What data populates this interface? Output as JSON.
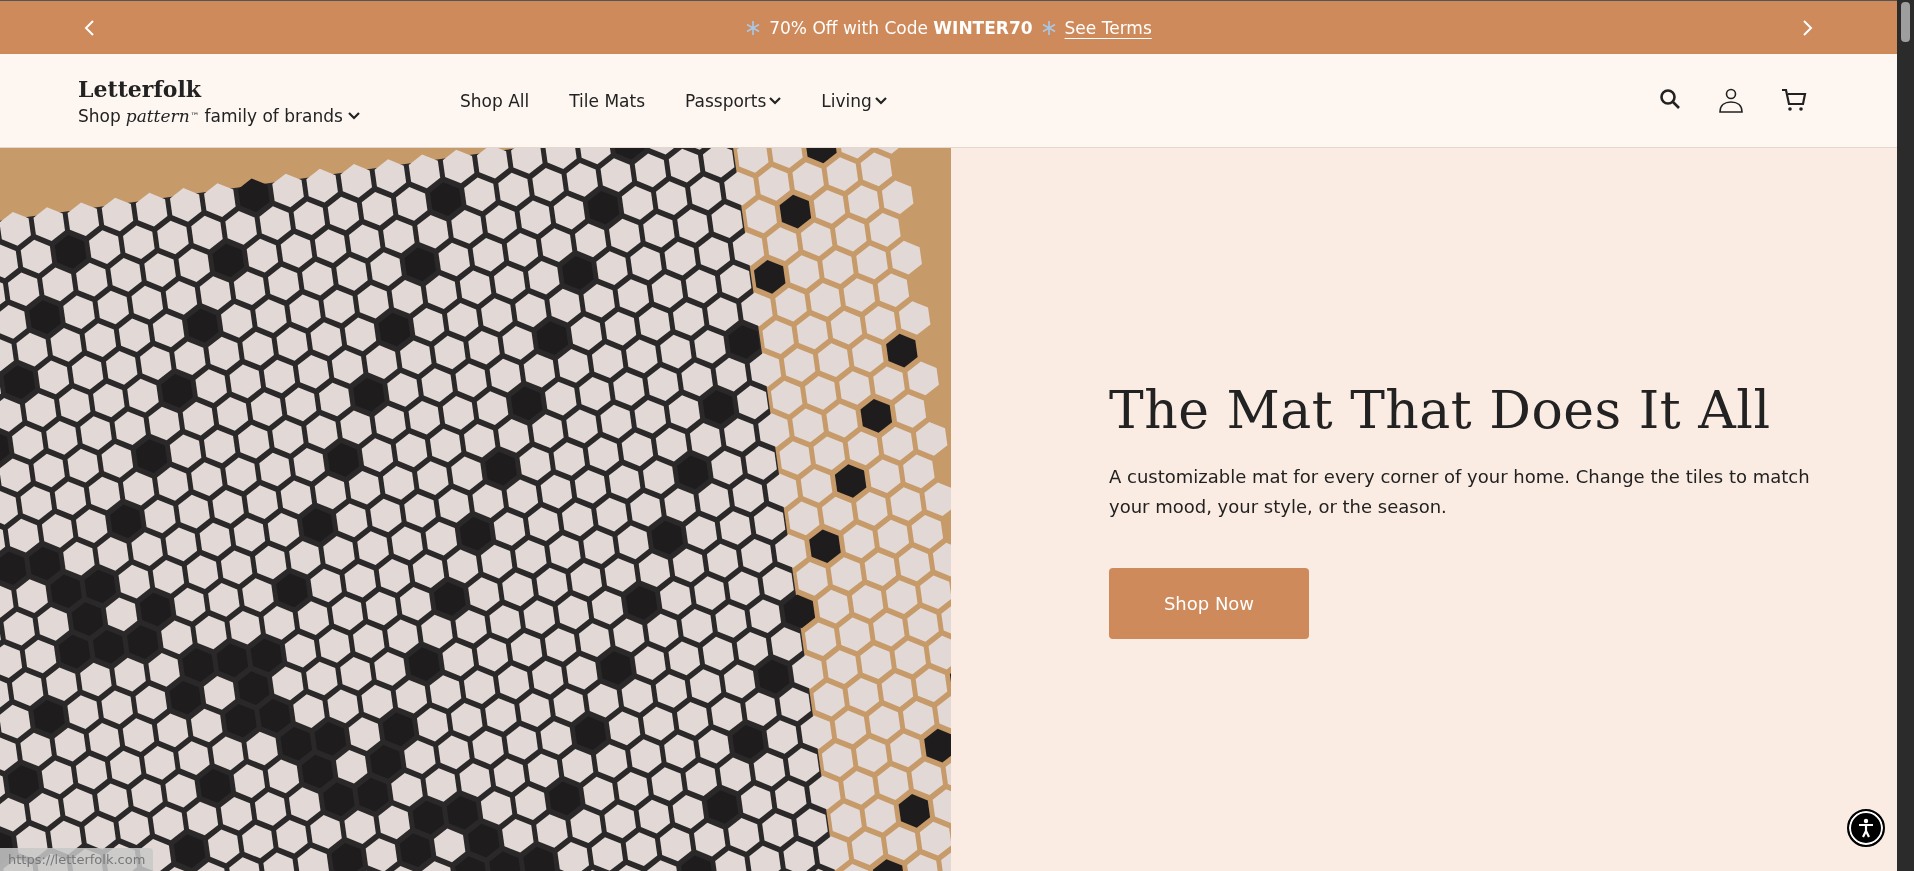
{
  "promo_bar": {
    "message": "70% Off with Code **WINTER70**",
    "link": "See Terms"
  },
  "header": {
    "logo": "Letterfolk",
    "family": {
      "prefix": "Shop",
      "brand": "pattern",
      "mark": "™",
      "suffix": "family of brands"
    },
    "nav": [
      {
        "label": "Shop All",
        "kind": "link"
      },
      {
        "label": "Tile Mats",
        "kind": "link"
      },
      {
        "label": "Passports",
        "kind": "dropdown"
      },
      {
        "label": "Living",
        "kind": "dropdown"
      }
    ]
  },
  "hero": {
    "title": "The Mat That Does It All",
    "text": "A customizable mat for every corner of your home. Change the tiles to match your mood, your style, or the season.",
    "button": "Shop Now"
  },
  "status_url": "https://letterfolk.com"
}
